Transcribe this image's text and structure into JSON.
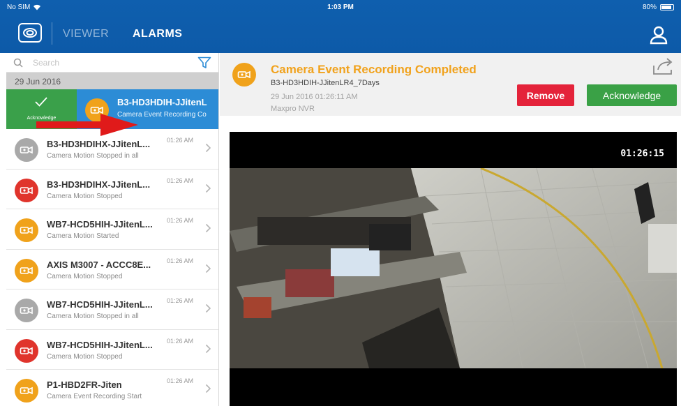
{
  "status_bar": {
    "carrier": "No SIM",
    "time": "1:03 PM",
    "battery": "80%"
  },
  "header": {
    "tabs": [
      {
        "label": "VIEWER"
      },
      {
        "label": "ALARMS"
      }
    ]
  },
  "sidebar": {
    "search_placeholder": "Search",
    "date_group": "29 Jun 2016",
    "swipe_action": {
      "label": "Acknowledge"
    },
    "selected_item": {
      "title": "B3-HD3HDIH-JJitenL",
      "subtitle": "Camera Event Recording Co"
    },
    "items": [
      {
        "title": "B3-HD3HDIHX-JJitenL...",
        "subtitle": "Camera Motion Stopped in all",
        "time": "01:26 AM",
        "color": "#a9a9a9"
      },
      {
        "title": "B3-HD3HDIHX-JJitenL...",
        "subtitle": "Camera Motion Stopped",
        "time": "01:26 AM",
        "color": "#e0342c"
      },
      {
        "title": "WB7-HCD5HIH-JJitenL...",
        "subtitle": "Camera Motion Started",
        "time": "01:26 AM",
        "color": "#f0a21b"
      },
      {
        "title": "AXIS M3007 - ACCC8E...",
        "subtitle": "Camera Motion Stopped",
        "time": "01:26 AM",
        "color": "#f0a21b"
      },
      {
        "title": "WB7-HCD5HIH-JJitenL...",
        "subtitle": "Camera Motion Stopped in all",
        "time": "01:26 AM",
        "color": "#a9a9a9"
      },
      {
        "title": "WB7-HCD5HIH-JJitenL...",
        "subtitle": "Camera Motion Stopped",
        "time": "01:26 AM",
        "color": "#e0342c"
      },
      {
        "title": "P1-HBD2FR-Jiten",
        "subtitle": "Camera Event Recording Start",
        "time": "01:26 AM",
        "color": "#f0a21b"
      }
    ]
  },
  "detail": {
    "title": "Camera Event Recording Completed",
    "source": "B3-HD3HDIH-JJitenLR4_7Days",
    "datetime": "29 Jun 2016 01:26:11 AM",
    "nvr": "Maxpro NVR",
    "remove_label": "Remove",
    "acknowledge_label": "Acknowledge"
  },
  "video": {
    "timestamp": "01:26:15"
  },
  "colors": {
    "header_blue": "#0f5fae",
    "accent_orange": "#f1a21c",
    "remove_red": "#e4233a",
    "ack_green": "#3aa146",
    "selected_blue": "#2c8cd6"
  }
}
